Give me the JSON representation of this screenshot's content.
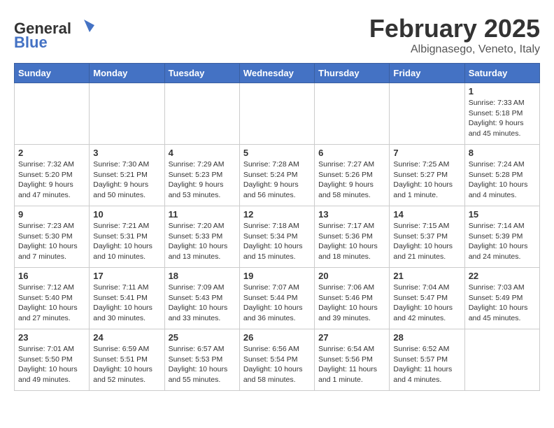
{
  "header": {
    "logo_general": "General",
    "logo_blue": "Blue",
    "title": "February 2025",
    "subtitle": "Albignasego, Veneto, Italy"
  },
  "weekdays": [
    "Sunday",
    "Monday",
    "Tuesday",
    "Wednesday",
    "Thursday",
    "Friday",
    "Saturday"
  ],
  "weeks": [
    [
      {
        "day": "",
        "info": ""
      },
      {
        "day": "",
        "info": ""
      },
      {
        "day": "",
        "info": ""
      },
      {
        "day": "",
        "info": ""
      },
      {
        "day": "",
        "info": ""
      },
      {
        "day": "",
        "info": ""
      },
      {
        "day": "1",
        "info": "Sunrise: 7:33 AM\nSunset: 5:18 PM\nDaylight: 9 hours and 45 minutes."
      }
    ],
    [
      {
        "day": "2",
        "info": "Sunrise: 7:32 AM\nSunset: 5:20 PM\nDaylight: 9 hours and 47 minutes."
      },
      {
        "day": "3",
        "info": "Sunrise: 7:30 AM\nSunset: 5:21 PM\nDaylight: 9 hours and 50 minutes."
      },
      {
        "day": "4",
        "info": "Sunrise: 7:29 AM\nSunset: 5:23 PM\nDaylight: 9 hours and 53 minutes."
      },
      {
        "day": "5",
        "info": "Sunrise: 7:28 AM\nSunset: 5:24 PM\nDaylight: 9 hours and 56 minutes."
      },
      {
        "day": "6",
        "info": "Sunrise: 7:27 AM\nSunset: 5:26 PM\nDaylight: 9 hours and 58 minutes."
      },
      {
        "day": "7",
        "info": "Sunrise: 7:25 AM\nSunset: 5:27 PM\nDaylight: 10 hours and 1 minute."
      },
      {
        "day": "8",
        "info": "Sunrise: 7:24 AM\nSunset: 5:28 PM\nDaylight: 10 hours and 4 minutes."
      }
    ],
    [
      {
        "day": "9",
        "info": "Sunrise: 7:23 AM\nSunset: 5:30 PM\nDaylight: 10 hours and 7 minutes."
      },
      {
        "day": "10",
        "info": "Sunrise: 7:21 AM\nSunset: 5:31 PM\nDaylight: 10 hours and 10 minutes."
      },
      {
        "day": "11",
        "info": "Sunrise: 7:20 AM\nSunset: 5:33 PM\nDaylight: 10 hours and 13 minutes."
      },
      {
        "day": "12",
        "info": "Sunrise: 7:18 AM\nSunset: 5:34 PM\nDaylight: 10 hours and 15 minutes."
      },
      {
        "day": "13",
        "info": "Sunrise: 7:17 AM\nSunset: 5:36 PM\nDaylight: 10 hours and 18 minutes."
      },
      {
        "day": "14",
        "info": "Sunrise: 7:15 AM\nSunset: 5:37 PM\nDaylight: 10 hours and 21 minutes."
      },
      {
        "day": "15",
        "info": "Sunrise: 7:14 AM\nSunset: 5:39 PM\nDaylight: 10 hours and 24 minutes."
      }
    ],
    [
      {
        "day": "16",
        "info": "Sunrise: 7:12 AM\nSunset: 5:40 PM\nDaylight: 10 hours and 27 minutes."
      },
      {
        "day": "17",
        "info": "Sunrise: 7:11 AM\nSunset: 5:41 PM\nDaylight: 10 hours and 30 minutes."
      },
      {
        "day": "18",
        "info": "Sunrise: 7:09 AM\nSunset: 5:43 PM\nDaylight: 10 hours and 33 minutes."
      },
      {
        "day": "19",
        "info": "Sunrise: 7:07 AM\nSunset: 5:44 PM\nDaylight: 10 hours and 36 minutes."
      },
      {
        "day": "20",
        "info": "Sunrise: 7:06 AM\nSunset: 5:46 PM\nDaylight: 10 hours and 39 minutes."
      },
      {
        "day": "21",
        "info": "Sunrise: 7:04 AM\nSunset: 5:47 PM\nDaylight: 10 hours and 42 minutes."
      },
      {
        "day": "22",
        "info": "Sunrise: 7:03 AM\nSunset: 5:49 PM\nDaylight: 10 hours and 45 minutes."
      }
    ],
    [
      {
        "day": "23",
        "info": "Sunrise: 7:01 AM\nSunset: 5:50 PM\nDaylight: 10 hours and 49 minutes."
      },
      {
        "day": "24",
        "info": "Sunrise: 6:59 AM\nSunset: 5:51 PM\nDaylight: 10 hours and 52 minutes."
      },
      {
        "day": "25",
        "info": "Sunrise: 6:57 AM\nSunset: 5:53 PM\nDaylight: 10 hours and 55 minutes."
      },
      {
        "day": "26",
        "info": "Sunrise: 6:56 AM\nSunset: 5:54 PM\nDaylight: 10 hours and 58 minutes."
      },
      {
        "day": "27",
        "info": "Sunrise: 6:54 AM\nSunset: 5:56 PM\nDaylight: 11 hours and 1 minute."
      },
      {
        "day": "28",
        "info": "Sunrise: 6:52 AM\nSunset: 5:57 PM\nDaylight: 11 hours and 4 minutes."
      },
      {
        "day": "",
        "info": ""
      }
    ]
  ]
}
